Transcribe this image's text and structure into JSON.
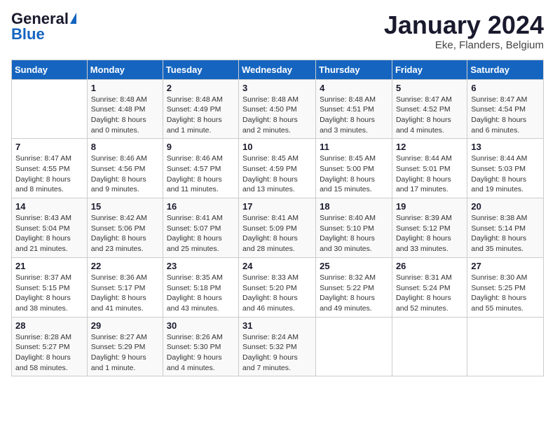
{
  "header": {
    "logo_general": "General",
    "logo_blue": "Blue",
    "month": "January 2024",
    "location": "Eke, Flanders, Belgium"
  },
  "weekdays": [
    "Sunday",
    "Monday",
    "Tuesday",
    "Wednesday",
    "Thursday",
    "Friday",
    "Saturday"
  ],
  "weeks": [
    [
      {
        "day": "",
        "info": ""
      },
      {
        "day": "1",
        "info": "Sunrise: 8:48 AM\nSunset: 4:48 PM\nDaylight: 8 hours\nand 0 minutes."
      },
      {
        "day": "2",
        "info": "Sunrise: 8:48 AM\nSunset: 4:49 PM\nDaylight: 8 hours\nand 1 minute."
      },
      {
        "day": "3",
        "info": "Sunrise: 8:48 AM\nSunset: 4:50 PM\nDaylight: 8 hours\nand 2 minutes."
      },
      {
        "day": "4",
        "info": "Sunrise: 8:48 AM\nSunset: 4:51 PM\nDaylight: 8 hours\nand 3 minutes."
      },
      {
        "day": "5",
        "info": "Sunrise: 8:47 AM\nSunset: 4:52 PM\nDaylight: 8 hours\nand 4 minutes."
      },
      {
        "day": "6",
        "info": "Sunrise: 8:47 AM\nSunset: 4:54 PM\nDaylight: 8 hours\nand 6 minutes."
      }
    ],
    [
      {
        "day": "7",
        "info": "Sunrise: 8:47 AM\nSunset: 4:55 PM\nDaylight: 8 hours\nand 8 minutes."
      },
      {
        "day": "8",
        "info": "Sunrise: 8:46 AM\nSunset: 4:56 PM\nDaylight: 8 hours\nand 9 minutes."
      },
      {
        "day": "9",
        "info": "Sunrise: 8:46 AM\nSunset: 4:57 PM\nDaylight: 8 hours\nand 11 minutes."
      },
      {
        "day": "10",
        "info": "Sunrise: 8:45 AM\nSunset: 4:59 PM\nDaylight: 8 hours\nand 13 minutes."
      },
      {
        "day": "11",
        "info": "Sunrise: 8:45 AM\nSunset: 5:00 PM\nDaylight: 8 hours\nand 15 minutes."
      },
      {
        "day": "12",
        "info": "Sunrise: 8:44 AM\nSunset: 5:01 PM\nDaylight: 8 hours\nand 17 minutes."
      },
      {
        "day": "13",
        "info": "Sunrise: 8:44 AM\nSunset: 5:03 PM\nDaylight: 8 hours\nand 19 minutes."
      }
    ],
    [
      {
        "day": "14",
        "info": "Sunrise: 8:43 AM\nSunset: 5:04 PM\nDaylight: 8 hours\nand 21 minutes."
      },
      {
        "day": "15",
        "info": "Sunrise: 8:42 AM\nSunset: 5:06 PM\nDaylight: 8 hours\nand 23 minutes."
      },
      {
        "day": "16",
        "info": "Sunrise: 8:41 AM\nSunset: 5:07 PM\nDaylight: 8 hours\nand 25 minutes."
      },
      {
        "day": "17",
        "info": "Sunrise: 8:41 AM\nSunset: 5:09 PM\nDaylight: 8 hours\nand 28 minutes."
      },
      {
        "day": "18",
        "info": "Sunrise: 8:40 AM\nSunset: 5:10 PM\nDaylight: 8 hours\nand 30 minutes."
      },
      {
        "day": "19",
        "info": "Sunrise: 8:39 AM\nSunset: 5:12 PM\nDaylight: 8 hours\nand 33 minutes."
      },
      {
        "day": "20",
        "info": "Sunrise: 8:38 AM\nSunset: 5:14 PM\nDaylight: 8 hours\nand 35 minutes."
      }
    ],
    [
      {
        "day": "21",
        "info": "Sunrise: 8:37 AM\nSunset: 5:15 PM\nDaylight: 8 hours\nand 38 minutes."
      },
      {
        "day": "22",
        "info": "Sunrise: 8:36 AM\nSunset: 5:17 PM\nDaylight: 8 hours\nand 41 minutes."
      },
      {
        "day": "23",
        "info": "Sunrise: 8:35 AM\nSunset: 5:18 PM\nDaylight: 8 hours\nand 43 minutes."
      },
      {
        "day": "24",
        "info": "Sunrise: 8:33 AM\nSunset: 5:20 PM\nDaylight: 8 hours\nand 46 minutes."
      },
      {
        "day": "25",
        "info": "Sunrise: 8:32 AM\nSunset: 5:22 PM\nDaylight: 8 hours\nand 49 minutes."
      },
      {
        "day": "26",
        "info": "Sunrise: 8:31 AM\nSunset: 5:24 PM\nDaylight: 8 hours\nand 52 minutes."
      },
      {
        "day": "27",
        "info": "Sunrise: 8:30 AM\nSunset: 5:25 PM\nDaylight: 8 hours\nand 55 minutes."
      }
    ],
    [
      {
        "day": "28",
        "info": "Sunrise: 8:28 AM\nSunset: 5:27 PM\nDaylight: 8 hours\nand 58 minutes."
      },
      {
        "day": "29",
        "info": "Sunrise: 8:27 AM\nSunset: 5:29 PM\nDaylight: 9 hours\nand 1 minute."
      },
      {
        "day": "30",
        "info": "Sunrise: 8:26 AM\nSunset: 5:30 PM\nDaylight: 9 hours\nand 4 minutes."
      },
      {
        "day": "31",
        "info": "Sunrise: 8:24 AM\nSunset: 5:32 PM\nDaylight: 9 hours\nand 7 minutes."
      },
      {
        "day": "",
        "info": ""
      },
      {
        "day": "",
        "info": ""
      },
      {
        "day": "",
        "info": ""
      }
    ]
  ]
}
